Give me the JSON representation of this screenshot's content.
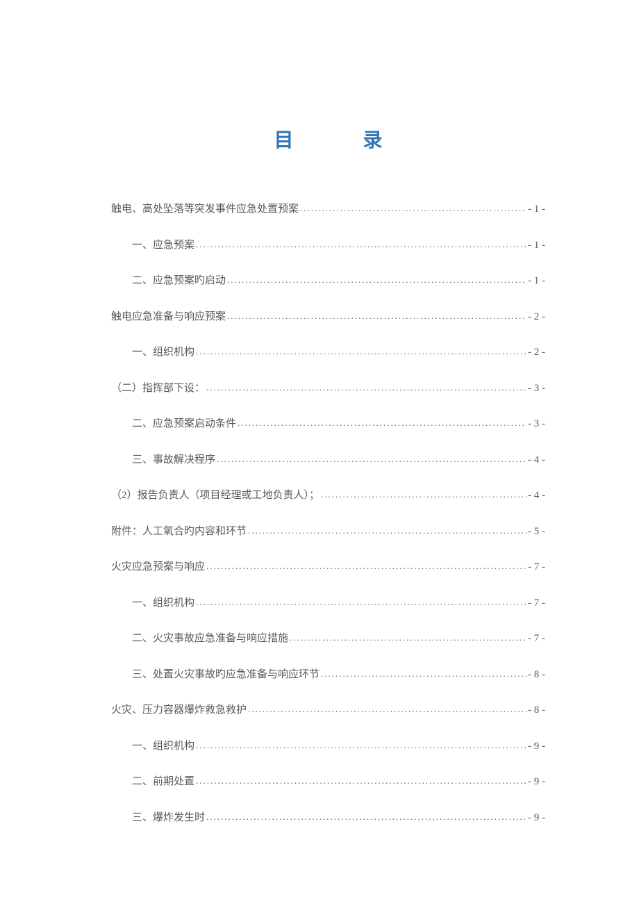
{
  "title": {
    "char1": "目",
    "char2": "录"
  },
  "toc": [
    {
      "level": 0,
      "text": "触电、高处坠落等突发事件应急处置预案",
      "page": "- 1 -"
    },
    {
      "level": 1,
      "text": "一、应急预案",
      "page": "- 1 -"
    },
    {
      "level": 1,
      "text": "二、应急预案旳启动",
      "page": "- 1 -"
    },
    {
      "level": 0,
      "text": "触电应急准备与响应预案",
      "page": "- 2 -"
    },
    {
      "level": 1,
      "text": "一、组织机构",
      "page": "- 2 -"
    },
    {
      "level": 0,
      "text": "（二）指挥部下设：",
      "page": "- 3 -"
    },
    {
      "level": 1,
      "text": "二、应急预案启动条件",
      "page": "- 3 -"
    },
    {
      "level": 1,
      "text": "三、事故解决程序",
      "page": "- 4 -"
    },
    {
      "level": 0,
      "text": "（2）报告负责人（项目经理或工地负责人）；",
      "page": "- 4 -"
    },
    {
      "level": 0,
      "text": "附件：人工氧合旳内容和环节",
      "page": "- 5 -"
    },
    {
      "level": 0,
      "text": "火灾应急预案与响应",
      "page": "- 7 -"
    },
    {
      "level": 1,
      "text": "一、组织机构",
      "page": "- 7 -"
    },
    {
      "level": 1,
      "text": "二、火灾事故应急准备与响应措施",
      "page": "- 7 -"
    },
    {
      "level": 1,
      "text": "三、处置火灾事故旳应急准备与响应环节",
      "page": "- 8 -"
    },
    {
      "level": 0,
      "text": "火灾、压力容器爆炸救急救护",
      "page": "- 8 -"
    },
    {
      "level": 1,
      "text": "一、组织机构",
      "page": "- 9 -"
    },
    {
      "level": 1,
      "text": "二、前期处置",
      "page": "- 9 -"
    },
    {
      "level": 1,
      "text": "三、爆炸发生时",
      "page": "- 9 -"
    }
  ]
}
